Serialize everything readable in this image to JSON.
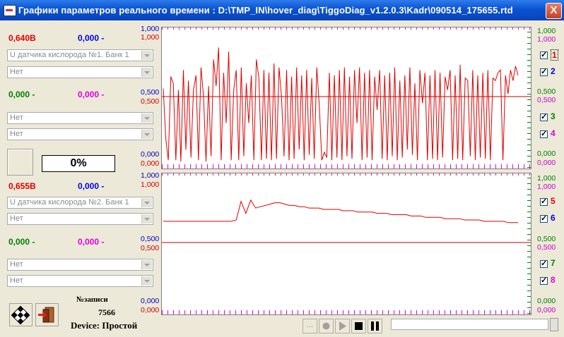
{
  "window": {
    "title": "Графики параметров реального времени : D:\\TMP_IN\\hover_diag\\TiggoDiag_v1.2.0.3\\Kadr\\090514_175655.rtd",
    "close": "X"
  },
  "top_group": {
    "value1": "0,640В",
    "value2": "0,000 -",
    "combo1": "U датчика кислорода №1. Банк 1",
    "combo2": "Нет",
    "value3": "0,000 -",
    "value4": "0,000 -",
    "combo3": "Нет",
    "combo4": "Нет"
  },
  "progress": "0%",
  "bottom_group": {
    "value1": "0,655В",
    "value2": "0,000 -",
    "combo1": "U датчика кислорода №2. Банк 1",
    "combo2": "Нет",
    "value3": "0,000 -",
    "value4": "0,000 -",
    "combo3": "Нет",
    "combo4": "Нет"
  },
  "record": {
    "label": "№записи",
    "count": "7566"
  },
  "device": "Device: Простой",
  "axis_labels": {
    "max": "1,000",
    "mid": "0,500",
    "min": "0,000"
  },
  "channels": [
    {
      "num": "1",
      "checked": true,
      "color": "#E00000"
    },
    {
      "num": "2",
      "checked": true,
      "color": "#0000E0"
    },
    {
      "num": "3",
      "checked": true,
      "color": "#008000"
    },
    {
      "num": "4",
      "checked": true,
      "color": "#E000E0"
    },
    {
      "num": "5",
      "checked": true,
      "color": "#E00000"
    },
    {
      "num": "6",
      "checked": true,
      "color": "#0000E0"
    },
    {
      "num": "7",
      "checked": true,
      "color": "#008000"
    },
    {
      "num": "8",
      "checked": true,
      "color": "#E000E0"
    }
  ],
  "playback": {
    "more_label": "...",
    "icons": [
      "record-icon",
      "play-icon",
      "stop-icon",
      "pause-icon"
    ]
  },
  "chart_data": [
    {
      "type": "line",
      "series": [
        {
          "values": [
            0.56,
            0.18,
            0.02,
            0.65,
            0.6,
            0.02,
            0.55,
            0.01,
            0.7,
            0.1,
            0.62,
            0.04,
            0.55,
            0.66,
            0.02,
            0.72,
            0.5,
            0.01,
            0.58,
            0.05,
            0.78,
            0.58,
            0.87,
            0.02,
            0.68,
            0.3,
            0.84,
            0.02,
            0.55,
            0.7,
            0.02,
            0.72,
            0.05,
            0.6,
            0.3,
            0.66,
            0.02,
            0.78,
            0.64,
            0.02,
            0.7,
            0.03,
            0.68,
            0.02,
            0.75,
            0.03,
            0.72,
            0.5,
            0.05,
            0.7,
            0.02,
            0.65,
            0.03,
            0.72,
            0.1,
            0.66,
            0.02,
            0.7,
            0.06,
            0.64,
            0.03,
            0.72,
            0.44,
            0.02,
            0.08,
            0.04,
            0.68,
            0.02,
            0.66,
            0.04,
            0.7,
            0.02,
            0.72,
            0.05,
            0.65,
            0.03,
            0.7,
            0.3,
            0.72,
            0.02,
            0.68,
            0.04,
            0.7,
            0.02,
            0.65,
            0.4,
            0.7,
            0.03,
            0.66,
            0.02,
            0.68,
            0.05,
            0.72,
            0.02,
            0.62,
            0.04,
            0.66,
            0.1,
            0.72,
            0.06,
            0.6,
            0.02,
            0.7,
            0.45,
            0.68,
            0.02,
            0.66,
            0.03,
            0.7,
            0.02,
            0.68,
            0.04,
            0.65,
            0.55,
            0.7,
            0.02,
            0.66,
            0.03,
            0.74,
            0.02,
            0.64,
            0.62,
            0.05,
            0.7,
            0.02,
            0.66,
            0.04,
            0.68,
            0.03,
            0.7,
            0.02,
            0.64,
            0.62,
            0.68,
            0.7,
            0.02,
            0.66,
            0.52,
            0.7,
            0.62,
            0.73,
            0.66
          ]
        },
        {
          "values": [
            0.0
          ]
        },
        {
          "values": [
            0.0
          ]
        },
        {
          "values": [
            0.0
          ]
        }
      ]
    },
    {
      "type": "line",
      "series": [
        {
          "values": [
            0.66,
            0.66,
            0.66,
            0.66,
            0.66,
            0.66,
            0.66,
            0.66,
            0.66,
            0.66,
            0.66,
            0.66,
            0.66,
            0.66,
            0.66,
            0.67,
            0.81,
            0.72,
            0.82,
            0.76,
            0.77,
            0.78,
            0.79,
            0.8,
            0.8,
            0.79,
            0.78,
            0.78,
            0.77,
            0.77,
            0.76,
            0.76,
            0.76,
            0.75,
            0.75,
            0.75,
            0.75,
            0.74,
            0.74,
            0.74,
            0.73,
            0.73,
            0.73,
            0.73,
            0.72,
            0.72,
            0.72,
            0.71,
            0.71,
            0.71,
            0.71,
            0.7,
            0.7,
            0.7,
            0.69,
            0.69,
            0.69,
            0.69,
            0.68,
            0.68,
            0.68,
            0.68,
            0.67,
            0.67,
            0.67,
            0.67,
            0.66,
            0.66,
            0.66,
            0.66,
            0.66,
            0.65,
            0.65,
            0.65
          ]
        },
        {
          "values": [
            0.0
          ]
        },
        {
          "values": [
            0.0
          ]
        },
        {
          "values": [
            0.0
          ]
        }
      ]
    }
  ]
}
